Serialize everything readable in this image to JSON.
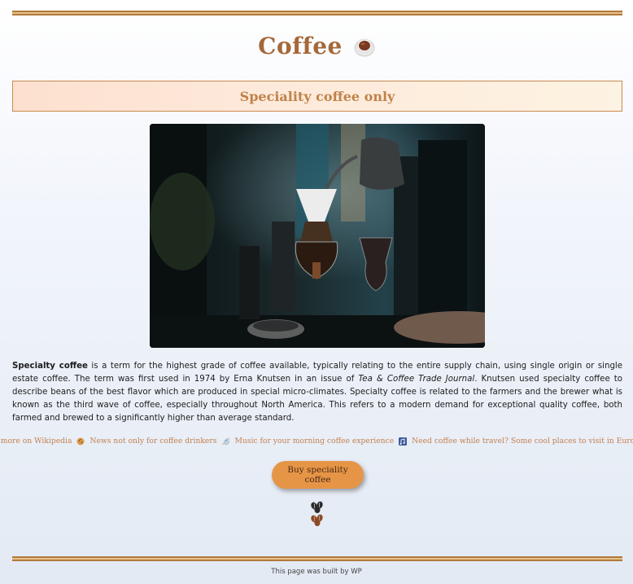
{
  "page": {
    "title": "Coffee",
    "banner": "Speciality coffee only",
    "photo_alt": "Pour-over coffee being brewed with a gooseneck kettle",
    "paragraph": {
      "lead_bold": "Specialty coffee",
      "text_1": " is a term for the highest grade of coffee available, typically relating to the entire supply chain, using single origin or single estate coffee. The term was first used in 1974 by Erna Knutsen in an issue of ",
      "journal_italic": "Tea & Coffee Trade Journal",
      "text_2": ". Knutsen used specialty coffee to describe beans of the best flavor which are produced in special micro-climates. Specialty coffee is related to the farmers and the brewer what is known as the third wave of coffee, especially throughout North America. This refers to a modern demand for exceptional quality coffee, both farmed and brewed to a significantly higher than average standard."
    },
    "links": [
      {
        "label": "Learn more on Wikipedia",
        "icon": "cookie-icon"
      },
      {
        "label": "News not only for coffee drinkers",
        "icon": "rocket-icon"
      },
      {
        "label": "Music for your morning coffee experience",
        "icon": "music-notes-icon"
      },
      {
        "label": "Need coffee while travel? Some cool places to visit in Europe",
        "icon": "landscape-icon"
      }
    ],
    "buy_button": "Buy speciality coffee",
    "footer": "This page was built by WP"
  },
  "colors": {
    "brand_brown": "#a5683a",
    "button_orange": "#e69547",
    "link_color": "#c28050"
  }
}
